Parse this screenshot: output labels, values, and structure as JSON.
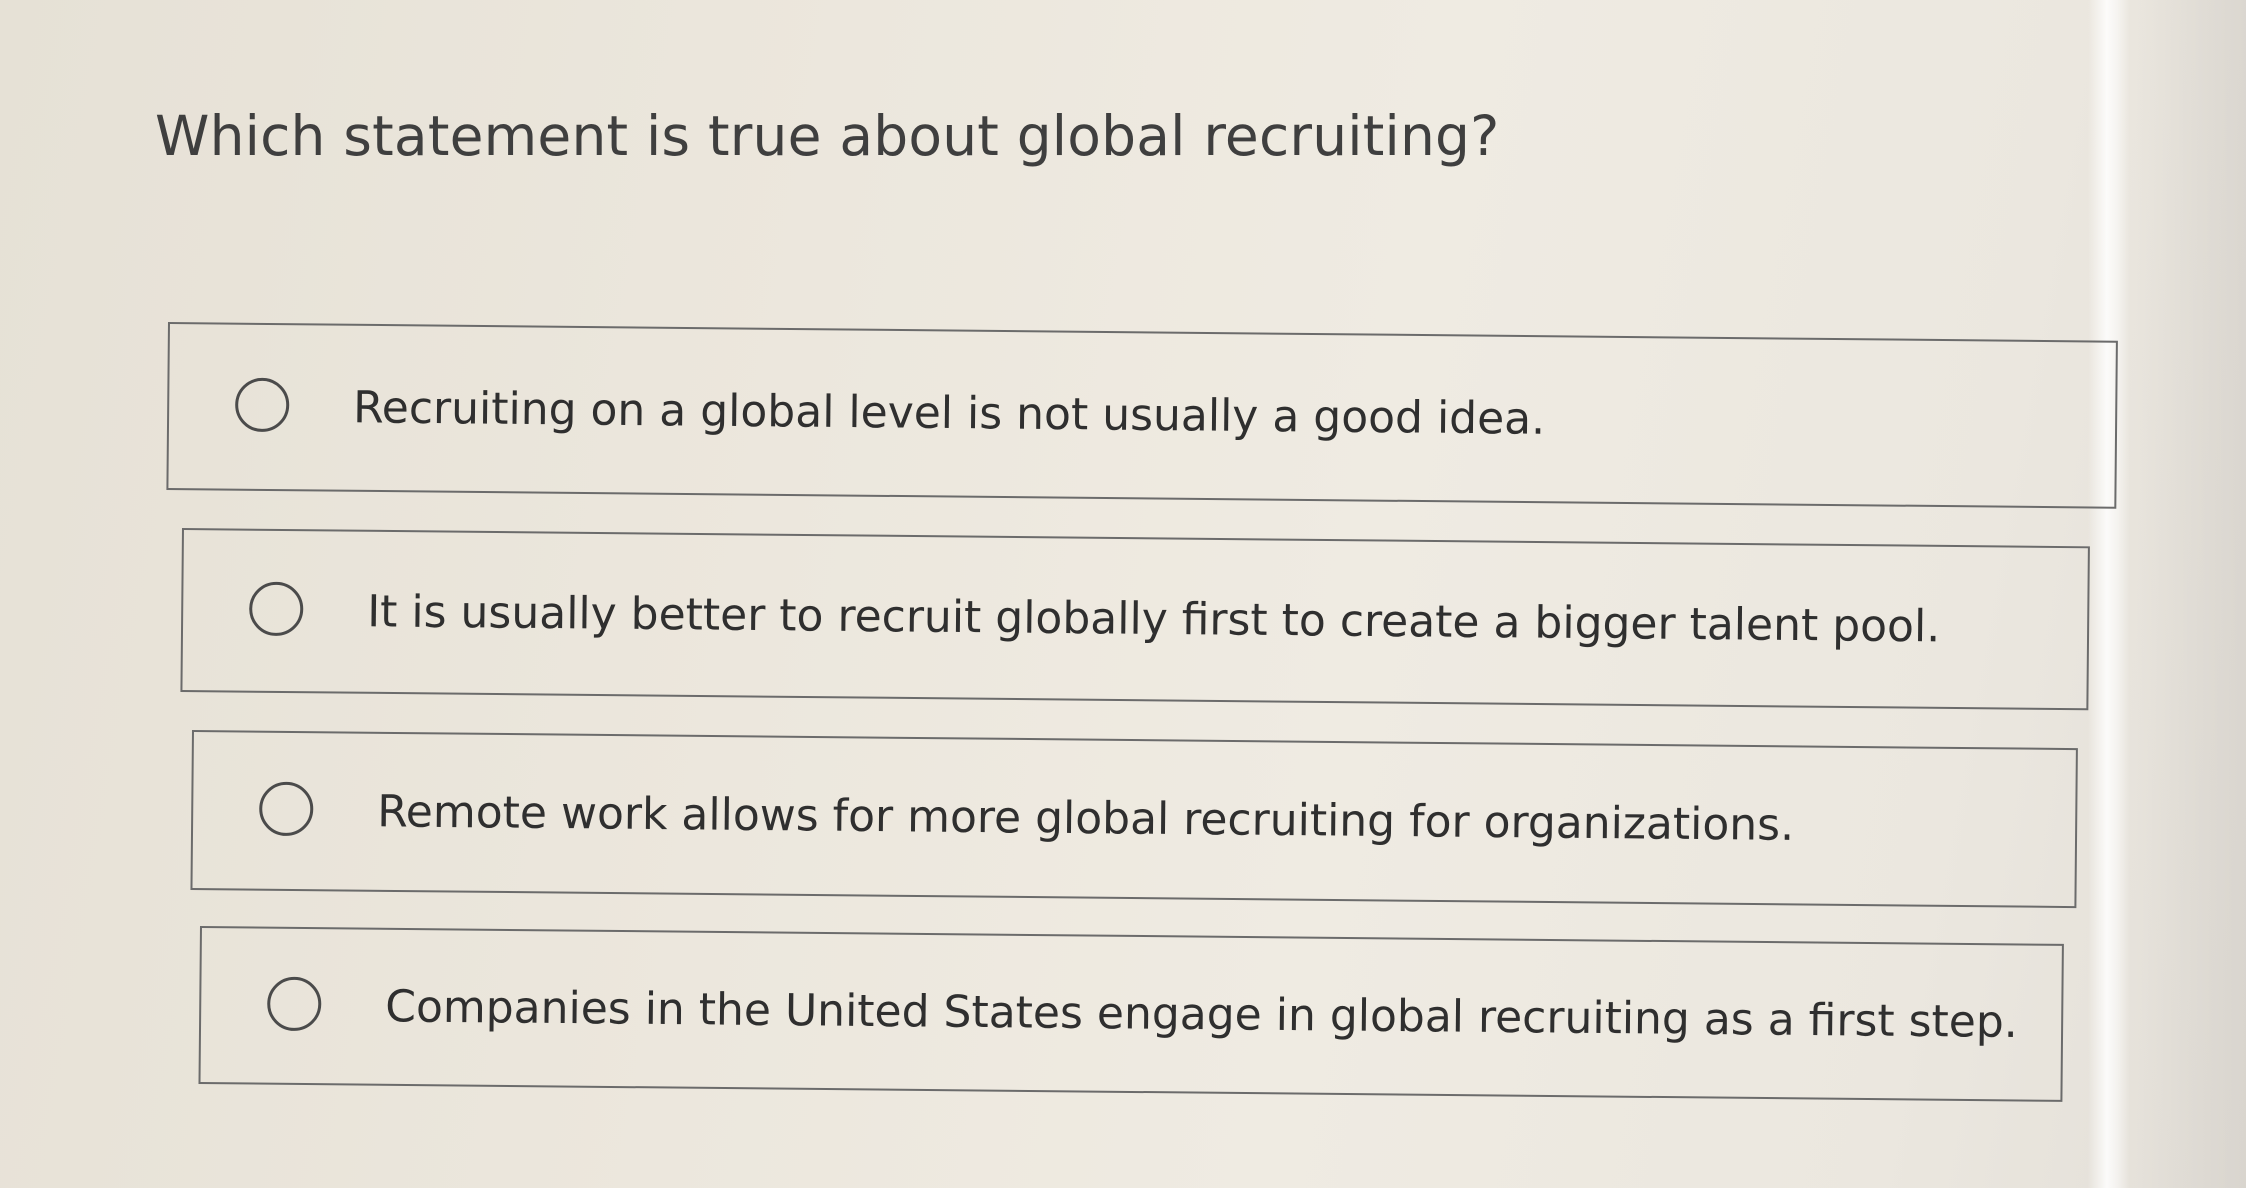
{
  "question": {
    "text": "Which statement is true about global recruiting?"
  },
  "options": [
    {
      "label": "Recruiting on a global level is not usually a good idea.",
      "selected": false
    },
    {
      "label": "It is usually better to recruit globally first to create a bigger talent pool.",
      "selected": false
    },
    {
      "label": "Remote work allows for more global recruiting for organizations.",
      "selected": false
    },
    {
      "label": "Companies in the United States engage in global recruiting as a first step.",
      "selected": false
    }
  ],
  "colors": {
    "background": "#ece7dd",
    "border": "#6b6b6b",
    "text": "#2f2f2f"
  },
  "icons": {
    "option_marker": "radio-unchecked-icon"
  }
}
